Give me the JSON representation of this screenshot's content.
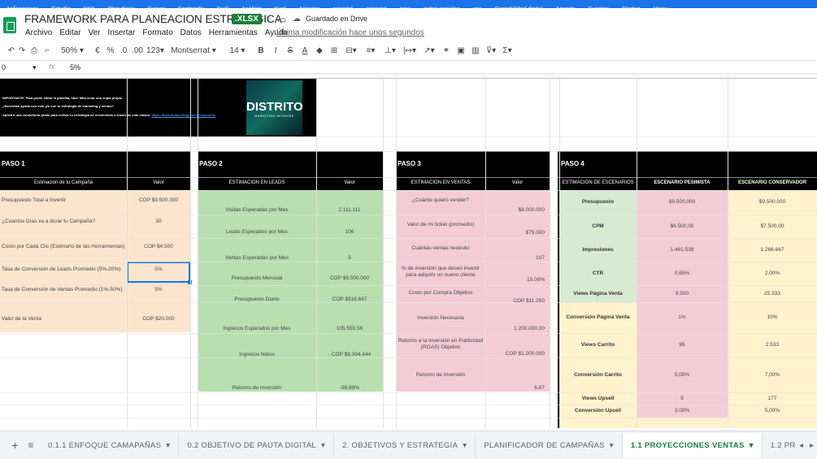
{
  "bookmarks": [
    "Aplicaciones",
    "Estudio",
    "YKK",
    "Blog diario",
    "Cursor",
    "Contenido",
    "Cuál",
    "Análisis",
    "Cual",
    "Amazon",
    "panamá",
    "panamá",
    "pow",
    "redes sociales",
    "cnc",
    "Contabilidad digital",
    "Agenda",
    "Eventos",
    "Startup",
    "Ideas"
  ],
  "doc": {
    "title": "FRAMEWORK PARA PLANEACION ESTRATEGICA",
    "badge": ".XLSX",
    "saved": "Guardado en Drive",
    "last_edit": "Última modificación hace unos segundos"
  },
  "menu": [
    "Archivo",
    "Editar",
    "Ver",
    "Insertar",
    "Formato",
    "Datos",
    "Herramientas",
    "Ayuda"
  ],
  "toolbar": {
    "zoom": "50%",
    "euro": "€",
    "percent": "%",
    "dec_less": ".0",
    "dec_more": ".00",
    "format": "123",
    "font": "Montserrat",
    "size": "14"
  },
  "formula": {
    "cell_ref": "0",
    "fx": "fx",
    "value": "5%"
  },
  "banner": {
    "line1": "IMPORTANTE: Para poder editar la plantilla, hace falta crear una copia propia.",
    "line2": "¿Necesitas ayuda con esto y/o con tu estrategia de marketing y ventas?",
    "line3": "Aplica a una consultoría gratis para revisar tu estrategia de crecimiento a través de este enlace:",
    "link": "https://distritomarketing.com/crecimiento",
    "logo_main": "DISTRITO",
    "logo_sub": "MARKETING NETWORK"
  },
  "paso1": {
    "title": "PASO 1",
    "col1": "Estimacion de tu Campaña",
    "col2": "Valor",
    "rows": [
      {
        "label": "Presupuesto Total a Invertir",
        "value": "COP $9.500.000"
      },
      {
        "label": "¿Cuantos Días va a durar tu Campaña?",
        "value": "30"
      },
      {
        "label": "Costo por Cada Clic (Estimarlo de las Herramientas)",
        "value": "COP $4.500"
      },
      {
        "label": "Tasa de Conversión de Leads Promedio (5%-20%)",
        "value": "5%"
      },
      {
        "label": "Tasa de Conversión de Ventas Promedio (1%-50%)",
        "value": "5%"
      },
      {
        "label": "Valor de la Venta",
        "value": "COP $20.000"
      }
    ]
  },
  "paso2": {
    "title": "PASO 2",
    "col1": "ESTIMACION EN LEADS",
    "col2": "Valor",
    "rows": [
      {
        "label": "Visitas Esperadas por Mes",
        "value": "2.111.111"
      },
      {
        "label": "Leads Esperados por Mes",
        "value": "106"
      },
      {
        "label": "Ventas Esperadas por Mes",
        "value": "5"
      },
      {
        "label": "Presupuesto Mensual",
        "value": "COP $9.500.000"
      },
      {
        "label": "Presupuesto Diario",
        "value": "COP $316.667"
      },
      {
        "label": "Ingresos Esperados por Mes",
        "value": "105.555,56"
      },
      {
        "label": "Ingresos Netos",
        "value": "- COP $9.394.444"
      },
      {
        "label": "Retorno de Inversión",
        "value": "-98,89%"
      }
    ]
  },
  "paso3": {
    "title": "PASO 3",
    "col1": "ESTIMACION EN VENTAS",
    "col2": "Valor",
    "rows": [
      {
        "label": "¿Cuánto quiero vender?",
        "value": "$8.000.000"
      },
      {
        "label": "Valor de mi ticket (promedio)",
        "value": "$75.000"
      },
      {
        "label": "Cuántas ventas necesito",
        "value": "107"
      },
      {
        "label": "% de inversión que deseo invertir para adquirir un nuevo cliente",
        "value": "15,00%"
      },
      {
        "label": "Costo por Compra Objetivo",
        "value": "COP $11.250"
      },
      {
        "label": "Inversión Necesaria",
        "value": "1.200.000,00"
      },
      {
        "label": "Retorno a la Inversión en Publicidad (ROAS) Objetivo",
        "value": "COP $1.200.000"
      },
      {
        "label": "Retorno de Inversión",
        "value": "6,67"
      }
    ]
  },
  "paso4": {
    "title": "PASO 4",
    "col1": "ESTIMACION DE ESCENARIOS",
    "col2": "ESCENARIO PESIMISTA",
    "col3": "ESCENARIO CONSERVADOR",
    "rows": [
      {
        "label": "Presupuesto",
        "pes": "$9.500.000",
        "con": "$9.500.000"
      },
      {
        "label": "CPM",
        "pes": "$6.500,00",
        "con": "$7.500,00"
      },
      {
        "label": "Impresiones",
        "pes": "1.461.538",
        "con": "1.266.667"
      },
      {
        "label": "CTR",
        "pes": "0,65%",
        "con": "2,00%"
      },
      {
        "label": "Views Página Venta",
        "pes": "9.500",
        "con": "25.333"
      },
      {
        "label": "Conversión Página Venta",
        "pes": "1%",
        "con": "10%"
      },
      {
        "label": "Views Carrito",
        "pes": "95",
        "con": "2.533"
      },
      {
        "label": "Conversión Carrito",
        "pes": "5,00%",
        "con": "7,00%"
      },
      {
        "label": "Views Upsell",
        "pes": "5",
        "con": "177"
      },
      {
        "label": "Conversión Upsell",
        "pes": "3,00%",
        "con": "5,00%"
      }
    ]
  },
  "tabs": [
    "0.1.1 ENFOQUE CAMAPAÑAS",
    "0.2 OBJETIVO DE PAUTA DIGITAL",
    "2. OBJETIVOS Y ESTRATEGIA",
    "PLANIFICADOR DE CAMPAÑAS",
    "1.1 PROYECCIONES VENTAS",
    "1.2 PROYECCIONE"
  ],
  "colors": {
    "peach": "#fce5cd",
    "green": "#b7dfb0",
    "pink": "#f4ccd8",
    "lightgreen": "#d9ead3",
    "yellow": "#fff2cc",
    "active_tab": "#188038"
  }
}
